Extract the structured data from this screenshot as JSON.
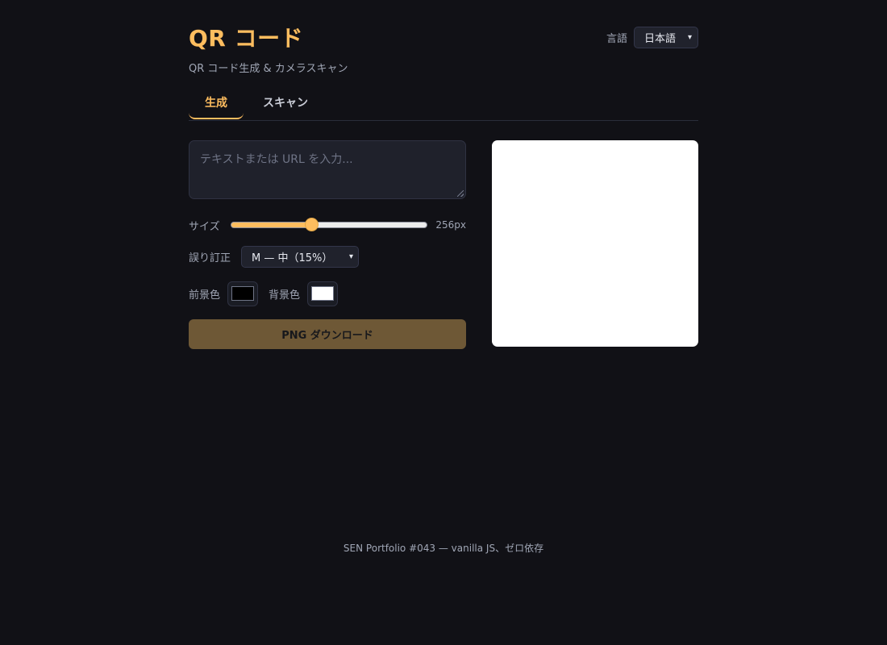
{
  "header": {
    "title": "QR コード",
    "subtitle": "QR コード生成 & カメラスキャン",
    "language_label": "言語",
    "language_value": "日本語"
  },
  "tabs": [
    {
      "label": "生成",
      "active": true
    },
    {
      "label": "スキャン",
      "active": false
    }
  ],
  "generator": {
    "text_placeholder": "テキストまたは URL を入力...",
    "text_value": "",
    "size_label": "サイズ",
    "size_value": "256px",
    "size_slider_fraction": 0.41,
    "ec_label": "誤り訂正",
    "ec_value": "M — 中（15%）",
    "fg_label": "前景色",
    "fg_color": "#000000",
    "bg_label": "背景色",
    "bg_color": "#ffffff",
    "download_label": "PNG ダウンロード"
  },
  "colors": {
    "accent": "#fdbd5f",
    "background": "#111116"
  },
  "icons": {
    "select_chevron": "chevron-down-icon",
    "textarea_grip": "resize-grip-icon"
  },
  "footer": {
    "text": "SEN Portfolio #043 — vanilla JS、ゼロ依存"
  }
}
